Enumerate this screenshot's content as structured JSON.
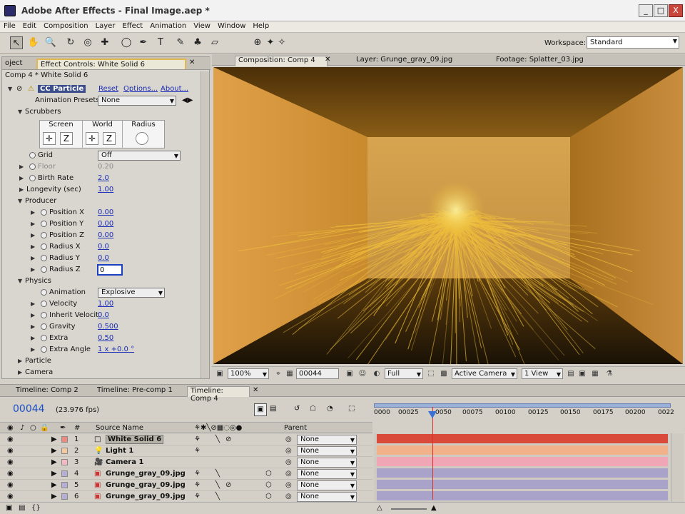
{
  "window": {
    "title": "Adobe After Effects - Final Image.aep *",
    "buttons": [
      "_",
      "□",
      "X"
    ]
  },
  "menu": [
    "File",
    "Edit",
    "Composition",
    "Layer",
    "Effect",
    "Animation",
    "View",
    "Window",
    "Help"
  ],
  "toolbar": {
    "workspace_label": "Workspace:",
    "workspace_value": "Standard"
  },
  "effect_panel": {
    "tabs": [
      "oject",
      "Effect Controls: White Solid 6"
    ],
    "header": "Comp 4 * White Solid 6",
    "effect_name": "CC Particle",
    "reset": "Reset",
    "options": "Options...",
    "about": "About...",
    "presets_label": "Animation Presets:",
    "presets_value": "None",
    "scrubbers_label": "Scrubbers",
    "scrubber_cols": [
      "Screen",
      "World",
      "Radius"
    ],
    "scrubber_z": "Z",
    "grid_label": "Grid",
    "grid_value": "Off",
    "floor_label": "Floor",
    "floor_value": "0.20",
    "birth_rate_label": "Birth Rate",
    "birth_rate_value": "2.0",
    "longevity_label": "Longevity (sec)",
    "longevity_value": "1.00",
    "producer_label": "Producer",
    "producer": [
      {
        "label": "Position X",
        "value": "0.00"
      },
      {
        "label": "Position Y",
        "value": "0.00"
      },
      {
        "label": "Position Z",
        "value": "0.00"
      },
      {
        "label": "Radius X",
        "value": "0.0"
      },
      {
        "label": "Radius Y",
        "value": "0.0"
      }
    ],
    "radius_z_label": "Radius Z",
    "radius_z_input": "0",
    "physics_label": "Physics",
    "animation_label": "Animation",
    "animation_value": "Explosive",
    "physics": [
      {
        "label": "Velocity",
        "value": "1.00"
      },
      {
        "label": "Inherit Velocit",
        "value": "0.0"
      },
      {
        "label": "Gravity",
        "value": "0.500"
      },
      {
        "label": "Extra",
        "value": "0.50"
      },
      {
        "label": "Extra Angle",
        "value": "1 x +0.0 °"
      }
    ],
    "particle_label": "Particle",
    "camera_label": "Camera"
  },
  "viewer": {
    "tabs": [
      "Composition: Comp 4",
      "Layer: Grunge_gray_09.jpg",
      "Footage: Splatter_03.jpg"
    ],
    "zoom": "100%",
    "timecode": "00044",
    "resolution": "Full",
    "camera": "Active Camera",
    "views": "1 View"
  },
  "timeline": {
    "tabs": [
      "Timeline: Comp 2",
      "Timeline: Pre-comp 1",
      "Timeline: Comp 4"
    ],
    "current_time": "00044",
    "fps": "(23.976 fps)",
    "col_hash": "#",
    "col_source": "Source Name",
    "col_parent": "Parent",
    "ruler_ticks": [
      "0000",
      "00025",
      "0050",
      "00075",
      "00100",
      "00125",
      "00150",
      "00175",
      "00200",
      "0022"
    ],
    "current_frame": 44,
    "layers": [
      {
        "num": "1",
        "name": "White Solid 6",
        "parent": "None",
        "color": "#d94a3a",
        "label": "#f08a80"
      },
      {
        "num": "2",
        "name": "Light 1",
        "parent": "None",
        "color": "#f1b18a",
        "label": "#f3c9a0"
      },
      {
        "num": "3",
        "name": "Camera 1",
        "parent": "None",
        "color": "#f0a6b4",
        "label": "#f3b9c2"
      },
      {
        "num": "4",
        "name": "Grunge_gray_09.jpg",
        "parent": "None",
        "color": "#a9a2c9",
        "label": "#b5b0d3"
      },
      {
        "num": "5",
        "name": "Grunge_gray_09.jpg",
        "parent": "None",
        "color": "#a9a2c9",
        "label": "#b5b0d3"
      },
      {
        "num": "6",
        "name": "Grunge_gray_09.jpg",
        "parent": "None",
        "color": "#a9a2c9",
        "label": "#b5b0d3"
      }
    ]
  }
}
